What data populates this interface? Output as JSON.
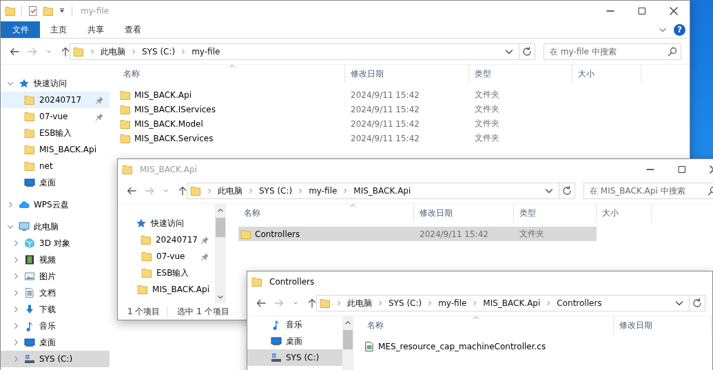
{
  "windows": [
    {
      "title": "my-file",
      "active": false,
      "ribbon": {
        "tabs": [
          {
            "label": "文件",
            "selected": true
          },
          {
            "label": "主页",
            "selected": false
          },
          {
            "label": "共享",
            "selected": false
          },
          {
            "label": "查看",
            "selected": false
          }
        ],
        "help": "?"
      },
      "path": [
        "此电脑",
        "SYS (C:)",
        "my-file"
      ],
      "search_placeholder": "在 my-file 中搜索",
      "nav": [
        {
          "label": "快速访问",
          "kind": "star",
          "expanded": true,
          "selected": false,
          "hovered": false,
          "children": [
            {
              "label": "20240717",
              "kind": "folder",
              "pinned": true,
              "selected": false,
              "hovered": true
            },
            {
              "label": "07-vue",
              "kind": "folder",
              "pinned": true,
              "selected": false,
              "hovered": false
            },
            {
              "label": "ESB输入",
              "kind": "folder",
              "pinned": false,
              "selected": false,
              "hovered": false
            },
            {
              "label": "MIS_BACK.Api",
              "kind": "folder",
              "pinned": false,
              "selected": false,
              "hovered": false
            },
            {
              "label": "net",
              "kind": "folder",
              "pinned": false,
              "selected": false,
              "hovered": false
            },
            {
              "label": "桌面",
              "kind": "desktop",
              "pinned": false,
              "selected": false,
              "hovered": false
            }
          ]
        },
        {
          "label": "WPS云盘",
          "kind": "cloud",
          "expanded": false,
          "selected": false,
          "hovered": false
        },
        {
          "label": "此电脑",
          "kind": "pc",
          "expanded": true,
          "selected": false,
          "hovered": false,
          "children": [
            {
              "label": "3D 对象",
              "kind": "cube",
              "expanded": false,
              "selected": false,
              "hovered": false
            },
            {
              "label": "视频",
              "kind": "video",
              "expanded": false,
              "selected": false,
              "hovered": false
            },
            {
              "label": "图片",
              "kind": "picture",
              "expanded": false,
              "selected": false,
              "hovered": false
            },
            {
              "label": "文档",
              "kind": "doc",
              "expanded": false,
              "selected": false,
              "hovered": false
            },
            {
              "label": "下载",
              "kind": "download",
              "expanded": false,
              "selected": false,
              "hovered": false
            },
            {
              "label": "音乐",
              "kind": "music",
              "expanded": false,
              "selected": false,
              "hovered": false
            },
            {
              "label": "桌面",
              "kind": "desktop",
              "expanded": false,
              "selected": false,
              "hovered": false
            },
            {
              "label": "SYS (C:)",
              "kind": "drive",
              "expanded": false,
              "selected": true,
              "hovered": false
            }
          ]
        }
      ],
      "columns": [
        "名称",
        "修改日期",
        "类型",
        "大小"
      ],
      "rows": [
        {
          "name": "MIS_BACK.Api",
          "kind": "folder",
          "modified": "2024/9/11 15:42",
          "type": "文件夹",
          "selected": false
        },
        {
          "name": "MIS_BACK.IServices",
          "kind": "folder",
          "modified": "2024/9/11 15:42",
          "type": "文件夹",
          "selected": false
        },
        {
          "name": "MIS_BACK.Model",
          "kind": "folder",
          "modified": "2024/9/11 15:42",
          "type": "文件夹",
          "selected": false
        },
        {
          "name": "MIS_BACK.Services",
          "kind": "folder",
          "modified": "2024/9/11 15:42",
          "type": "文件夹",
          "selected": false
        }
      ]
    },
    {
      "title": "MIS_BACK.Api",
      "active": false,
      "path": [
        "此电脑",
        "SYS (C:)",
        "my-file",
        "MIS_BACK.Api"
      ],
      "search_placeholder": "在 MIS_BACK.Api 中搜索",
      "nav": [
        {
          "label": "快速访问",
          "kind": "star",
          "selected": false,
          "hovered": false,
          "children": [
            {
              "label": "20240717",
              "kind": "folder",
              "pinned": true,
              "selected": false,
              "hovered": false
            },
            {
              "label": "07-vue",
              "kind": "folder",
              "pinned": true,
              "selected": false,
              "hovered": false
            },
            {
              "label": "ESB输入",
              "kind": "folder",
              "pinned": false,
              "selected": false,
              "hovered": false
            },
            {
              "label": "MIS_BACK.Api",
              "kind": "folder",
              "pinned": false,
              "selected": false,
              "hovered": false
            }
          ]
        }
      ],
      "columns": [
        "名称",
        "修改日期",
        "类型",
        "大小"
      ],
      "rows": [
        {
          "name": "Controllers",
          "kind": "folder",
          "modified": "2024/9/11 15:42",
          "type": "文件夹",
          "selected": true
        }
      ],
      "status": {
        "count": "1 个项目",
        "selection": "选中 1 个项目"
      }
    },
    {
      "title": "Controllers",
      "active": true,
      "path": [
        "此电脑",
        "SYS (C:)",
        "my-file",
        "MIS_BACK.Api",
        "Controllers"
      ],
      "nav": [
        {
          "label": "音乐",
          "kind": "music",
          "selected": false,
          "hovered": false
        },
        {
          "label": "桌面",
          "kind": "desktop",
          "selected": false,
          "hovered": false
        },
        {
          "label": "SYS (C:)",
          "kind": "drive",
          "selected": true,
          "hovered": false
        }
      ],
      "columns": [
        "名称",
        "修改日期"
      ],
      "rows": [
        {
          "name": "MES_resource_cap_machineController.cs",
          "kind": "file",
          "selected": false
        }
      ]
    }
  ]
}
